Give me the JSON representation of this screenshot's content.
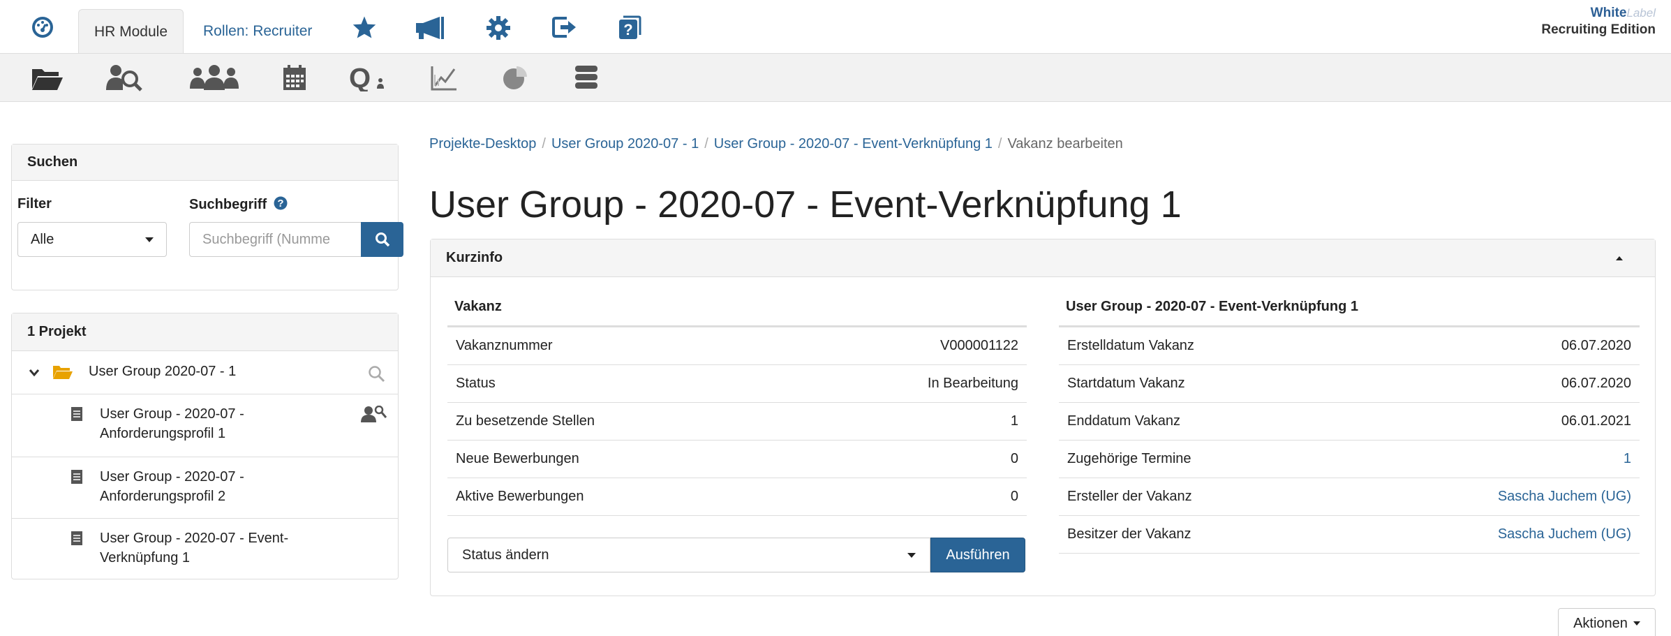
{
  "topbar": {
    "tab_hr": "HR Module",
    "tab_roles": "Rollen: Recruiter",
    "brand_white": "White",
    "brand_label": "Label",
    "brand_edition": "Recruiting Edition",
    "icons": [
      "dashboard-icon",
      "star-icon",
      "megaphone-icon",
      "gear-icon",
      "logout-icon",
      "help-icon"
    ]
  },
  "toolbar": {
    "icons": [
      "folder-open-icon",
      "search-person-icon",
      "users-icon",
      "calendar-icon",
      "q-query-icon",
      "chart-line-icon",
      "pie-chart-icon",
      "database-icon"
    ]
  },
  "search_panel": {
    "title": "Suchen",
    "filter_label": "Filter",
    "filter_value": "Alle",
    "term_label": "Suchbegriff",
    "term_placeholder": "Suchbegriff (Numme"
  },
  "project_panel": {
    "title": "1 Projekt",
    "root": "User Group 2020-07 - 1",
    "items": [
      {
        "line1": "User Group - 2020-07 -",
        "line2": "Anforderungsprofil 1"
      },
      {
        "line1": "User Group - 2020-07 -",
        "line2": "Anforderungsprofil 2"
      },
      {
        "line1": "User Group - 2020-07 - Event-",
        "line2": "Verknüpfung 1"
      }
    ]
  },
  "breadcrumb": {
    "items": [
      "Projekte-Desktop",
      "User Group 2020-07 - 1",
      "User Group - 2020-07 - Event-Verknüpfung 1"
    ],
    "current": "Vakanz bearbeiten"
  },
  "page_title": "User Group - 2020-07 - Event-Verknüpfung 1",
  "kurzinfo": {
    "title": "Kurzinfo",
    "left": {
      "header": "Vakanz",
      "rows": [
        {
          "label": "Vakanznummer",
          "value": "V000001122"
        },
        {
          "label": "Status",
          "value": "In Bearbeitung"
        },
        {
          "label": "Zu besetzende Stellen",
          "value": "1"
        },
        {
          "label": "Neue Bewerbungen",
          "value": "0"
        },
        {
          "label": "Aktive Bewerbungen",
          "value": "0"
        }
      ]
    },
    "right": {
      "header": "User Group - 2020-07 - Event-Verknüpfung 1",
      "rows": [
        {
          "label": "Erstelldatum Vakanz",
          "value": "06.07.2020"
        },
        {
          "label": "Startdatum Vakanz",
          "value": "06.07.2020"
        },
        {
          "label": "Enddatum Vakanz",
          "value": "06.01.2021"
        },
        {
          "label": "Zugehörige Termine",
          "value": "1"
        },
        {
          "label": "Ersteller der Vakanz",
          "value": "Sascha Juchem (UG)"
        },
        {
          "label": "Besitzer der Vakanz",
          "value": "Sascha Juchem (UG)"
        }
      ]
    },
    "status_select": "Status ändern",
    "run_button": "Ausführen"
  },
  "actions_button": "Aktionen",
  "colors": {
    "primary": "#2a6496",
    "link": "#2a6496",
    "toolbar_bg": "#f2f2f2"
  }
}
